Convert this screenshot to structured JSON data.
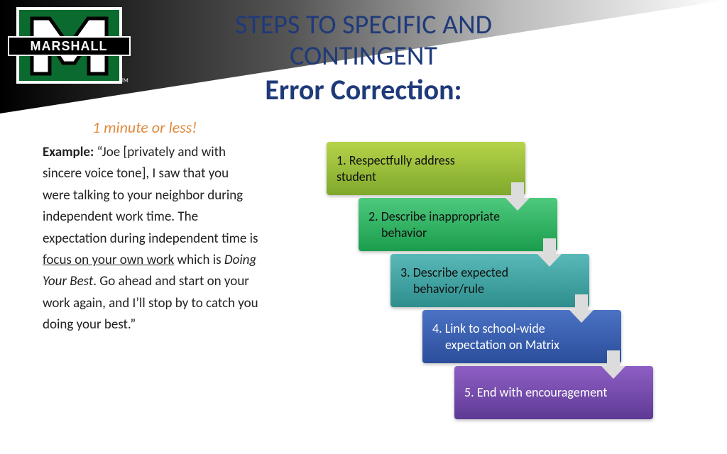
{
  "logo": {
    "brand": "MARSHALL"
  },
  "title": {
    "line1": "STEPS TO SPECIFIC AND",
    "line2": "CONTINGENT",
    "line3": "Error Correction:"
  },
  "subtitle": "1 minute or less!",
  "example": {
    "label": "Example:",
    "pre": " “Joe [privately and with sincere voice tone], I saw that you were talking to your neighbor during independent work time.  The expectation during independent time is ",
    "underlined": "focus on your own work",
    "mid1": " which is ",
    "italic": "Doing Your Best",
    "post": ". Go ahead and start on your work again, and I’ll stop by to catch you doing your best.”"
  },
  "steps": [
    {
      "first": "1. Respectfully address",
      "rest": "student"
    },
    {
      "first": "2. Describe inappropriate",
      "rest": "behavior"
    },
    {
      "first": "3. Describe expected",
      "rest": "behavior/rule"
    },
    {
      "first": "4. Link to school-wide",
      "rest": "expectation on Matrix"
    },
    {
      "first": "5. End with encouragement",
      "rest": ""
    }
  ]
}
